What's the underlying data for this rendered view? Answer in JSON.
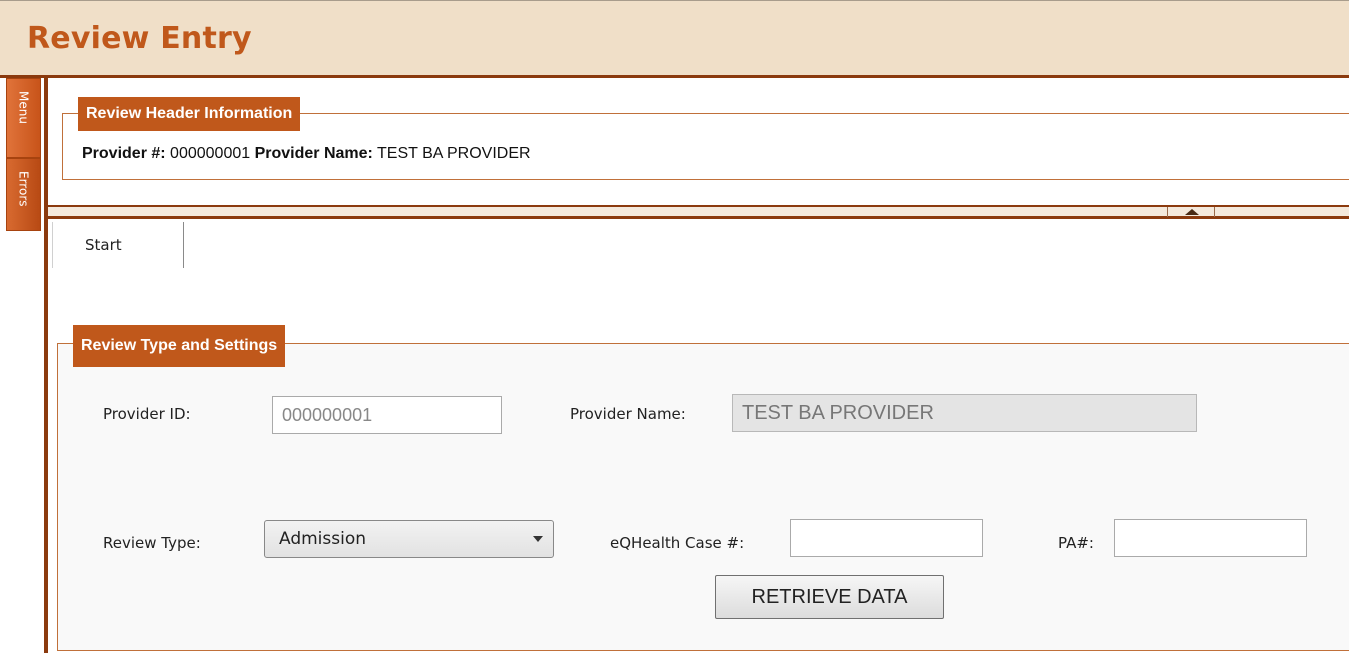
{
  "app": {
    "title": "Review Entry"
  },
  "side_tabs": {
    "menu": "Menu",
    "errors": "Errors"
  },
  "header": {
    "legend": "Review Header Information",
    "provider_num_label": "Provider #:",
    "provider_num_value": "000000001",
    "provider_name_label": "Provider Name:",
    "provider_name_value": "TEST BA PROVIDER"
  },
  "tabs": [
    {
      "label": "Start"
    }
  ],
  "settings": {
    "legend": "Review Type and Settings",
    "provider_id_label": "Provider ID:",
    "provider_id_value": "000000001",
    "provider_name_label": "Provider Name:",
    "provider_name_value": "TEST BA PROVIDER",
    "review_type_label": "Review Type:",
    "review_type_value": "Admission",
    "case_label": "eQHealth Case #:",
    "case_value": "",
    "pa_label": "PA#:",
    "pa_value": "",
    "retrieve_button": "RETRIEVE DATA"
  },
  "colors": {
    "accent": "#c0581b",
    "title_bg": "#f0dfc8",
    "border_dark": "#8b3a0e"
  }
}
